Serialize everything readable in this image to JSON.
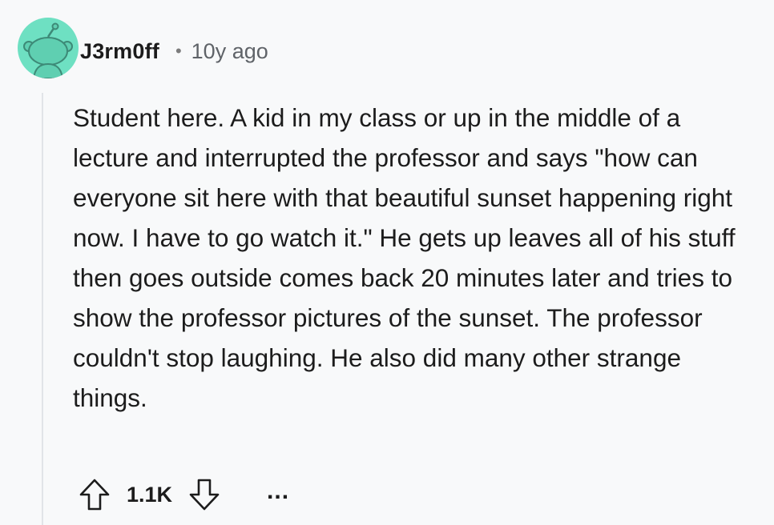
{
  "comment": {
    "author": "J3rm0ff",
    "separator": "•",
    "timestamp": "10y ago",
    "body": "Student here. A kid in my class or up in the middle of a lecture and interrupted the professor and says \"how can everyone sit here with that beautiful sunset happening right now. I have to go watch it.\" He gets up leaves all of his stuff then goes outside comes back 20 minutes later and tries to show the professor pictures of the sunset. The professor couldn't stop laughing. He also did many other strange things.",
    "score": "1.1K",
    "more_label": "..."
  },
  "icons": {
    "avatar": "reddit-snoo-avatar-icon",
    "upvote": "upvote-arrow-icon",
    "downvote": "downvote-arrow-icon",
    "more": "more-options-icon"
  },
  "colors": {
    "background": "#f8f9fa",
    "avatar_bg": "#6ee0c2",
    "text": "#1c1c1c",
    "meta_text": "#5f6368",
    "thread_line": "#e1e4e8"
  }
}
